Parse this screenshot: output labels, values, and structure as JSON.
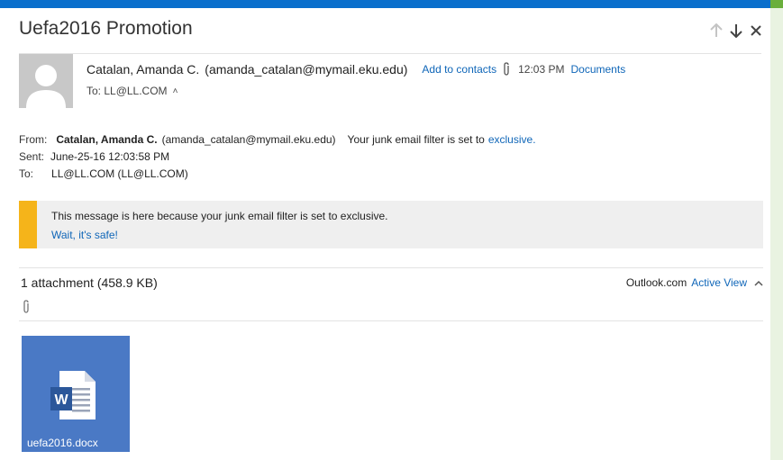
{
  "colors": {
    "accent": "#0a6fcc",
    "link": "#0f66b8",
    "warning": "#f5b41a",
    "tile": "#4a79c5"
  },
  "header": {
    "subject": "Uefa2016 Promotion",
    "nav_icons": [
      "arrow-up-icon",
      "arrow-down-icon",
      "close-icon"
    ]
  },
  "sender": {
    "name": "Catalan, Amanda C.",
    "email": "(amanda_catalan@mymail.eku.edu)",
    "add_contacts": "Add to contacts",
    "time": "12:03 PM",
    "documents": "Documents",
    "to": "To: LL@LL.COM"
  },
  "details": {
    "from_label": "From:",
    "from_name": "Catalan, Amanda C.",
    "from_email": "(amanda_catalan@mymail.eku.edu)",
    "junk_note": "Your junk email filter is set to",
    "junk_link": "exclusive.",
    "sent_label": "Sent:",
    "sent_value": "June-25-16 12:03:58 PM",
    "to_label": "To:",
    "to_value": "LL@LL.COM (LL@LL.COM)"
  },
  "junk_banner": {
    "message": "This message is here because your junk email filter is set to exclusive.",
    "safe_link": "Wait, it's safe!"
  },
  "attachments": {
    "summary": "1 attachment (458.9 KB)",
    "provider": "Outlook.com",
    "active_view": "Active View",
    "files": [
      {
        "name": "uefa2016.docx",
        "icon": "word-document-icon"
      }
    ]
  }
}
